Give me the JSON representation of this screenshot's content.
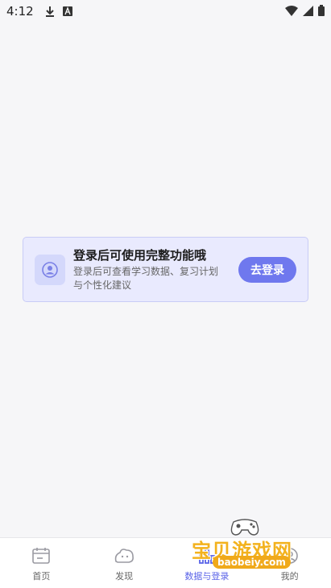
{
  "status_bar": {
    "time": "4:12"
  },
  "login_card": {
    "title": "登录后可使用完整功能哦",
    "description": "登录后可查看学习数据、复习计划与个性化建议",
    "button_label": "去登录"
  },
  "nav": {
    "items": [
      {
        "label": "首页",
        "icon": "home-icon",
        "active": false
      },
      {
        "label": "发现",
        "icon": "discover-icon",
        "active": false
      },
      {
        "label": "数据与登录",
        "icon": "data-icon",
        "active": true
      },
      {
        "label": "我的",
        "icon": "profile-icon",
        "active": false
      }
    ]
  },
  "watermark": {
    "text": "宝贝游戏网",
    "url": "baobeiy.com"
  },
  "colors": {
    "accent": "#6f78ee",
    "card_bg": "#e9eafe",
    "active_nav": "#5b64e8"
  }
}
